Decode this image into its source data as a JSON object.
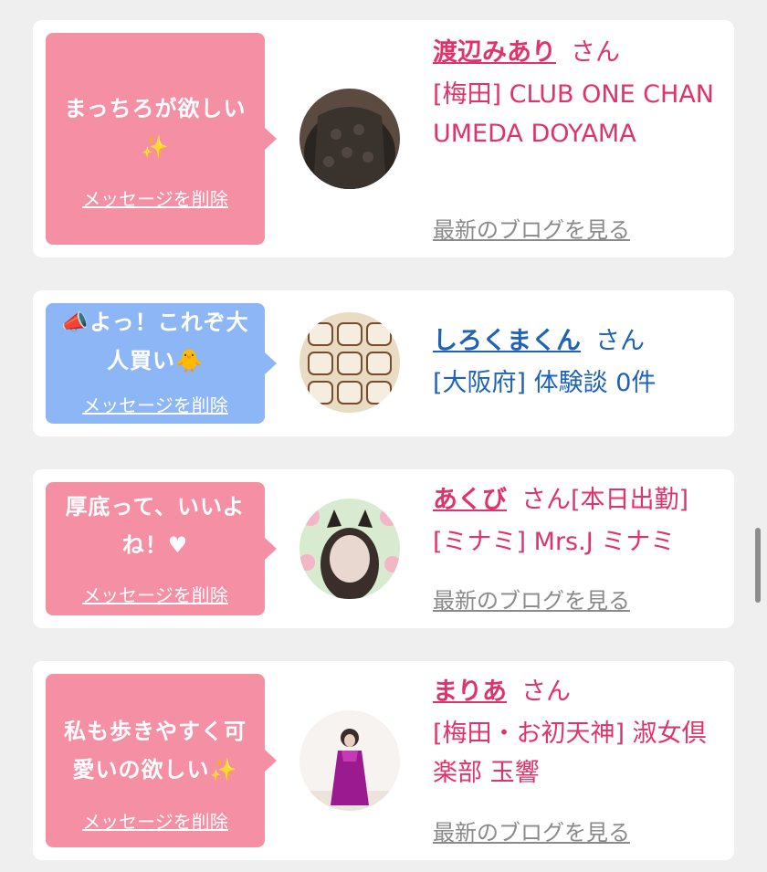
{
  "messages": [
    {
      "message": "まっちろが欲しい✨",
      "delete_label": "メッセージを削除",
      "name": "渡辺みあり",
      "honorific": "さん",
      "shop": "[梅田] CLUB ONE CHAN UMEDA DOYAMA",
      "blog_link": "最新のブログを見る",
      "bubble_color": "#f58fa4"
    },
    {
      "message": "📣よっ！これぞ大人買い🐥",
      "delete_label": "メッセージを削除",
      "name": "しろくまくん",
      "honorific": "さん",
      "shop": "[大阪府] 体験談 0件",
      "bubble_color": "#8db6f7"
    },
    {
      "message": "厚底って、いいよね！♥",
      "delete_label": "メッセージを削除",
      "name": "あくび",
      "honorific": "さん[本日出勤]",
      "shop": "[ミナミ] Mrs.J ミナミ",
      "blog_link": "最新のブログを見る",
      "bubble_color": "#f58fa4"
    },
    {
      "message": "私も歩きやすく可愛いの欲しい✨",
      "delete_label": "メッセージを削除",
      "name": "まりあ",
      "honorific": "さん",
      "shop": "[梅田・お初天神] 淑女倶楽部 玉響",
      "blog_link": "最新のブログを見る",
      "bubble_color": "#f58fa4"
    }
  ],
  "colors": {
    "accent_pink": "#e0336b",
    "accent_blue": "#1e63b8",
    "link_gray": "#8a8a8a"
  }
}
